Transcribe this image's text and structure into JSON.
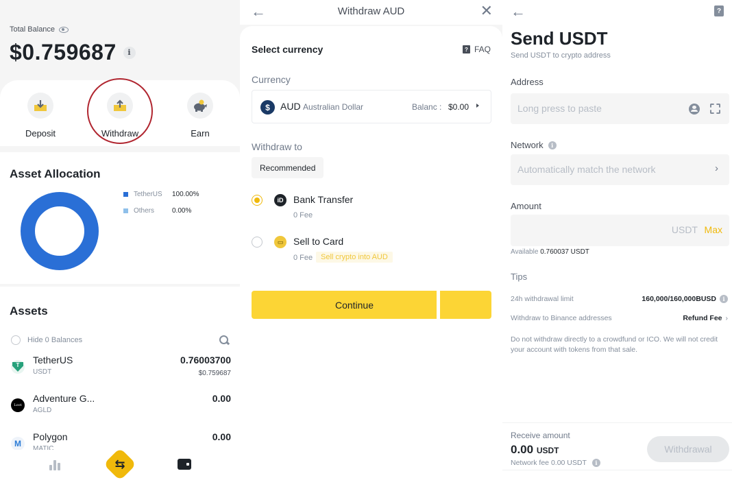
{
  "portfolio": {
    "total_balance_label": "Total Balance",
    "total_balance_value": "$0.759687",
    "info_glyph": "i",
    "actions": [
      {
        "label": "Deposit",
        "icon": "deposit-icon"
      },
      {
        "label": "Withdraw",
        "icon": "withdraw-icon",
        "highlighted": true
      },
      {
        "label": "Earn",
        "icon": "piggy-bank-icon"
      }
    ],
    "allocation": {
      "title": "Asset Allocation",
      "legend": [
        {
          "name": "TetherUS",
          "percent": "100.00%",
          "color": "#2a6fd6"
        },
        {
          "name": "Others",
          "percent": "0.00%",
          "color": "#8fc0ea"
        }
      ]
    },
    "assets": {
      "title": "Assets",
      "hide_zero_label": "Hide 0 Balances",
      "items": [
        {
          "name": "TetherUS",
          "symbol": "USDT",
          "amount": "0.76003700",
          "fiat": "$0.759687",
          "logo_glyph": "T"
        },
        {
          "name": "Adventure G...",
          "symbol": "AGLD",
          "amount": "0.00",
          "fiat": "",
          "logo_glyph": "Loot"
        },
        {
          "name": "Polygon",
          "symbol": "MATIC",
          "amount": "0.00",
          "fiat": "",
          "logo_glyph": "M"
        }
      ]
    },
    "bottom_nav": {
      "trade_glyph": "⇆"
    }
  },
  "withdraw_aud": {
    "back_glyph": "←",
    "title": "Withdraw AUD",
    "close_glyph": "✕",
    "select_currency": "Select currency",
    "faq_label": "FAQ",
    "faq_glyph": "?",
    "currency_label": "Currency",
    "currency": {
      "glyph": "$",
      "code": "AUD",
      "name": "Australian Dollar",
      "balance_label": "Balanc :",
      "balance_value": "$0.00"
    },
    "withdraw_to_label": "Withdraw to",
    "recommended_label": "Recommended",
    "methods": [
      {
        "title": "Bank Transfer",
        "fee": "0 Fee",
        "tag": "",
        "selected": true,
        "glyph": "iD"
      },
      {
        "title": "Sell to Card",
        "fee": "0 Fee",
        "tag": "Sell crypto into AUD",
        "selected": false,
        "glyph": "▭"
      }
    ],
    "continue_label": "Continue"
  },
  "send_usdt": {
    "back_glyph": "←",
    "help_glyph": "?",
    "title": "Send USDT",
    "subtitle": "Send USDT to crypto address",
    "address_label": "Address",
    "address_placeholder": "Long press to paste",
    "network_label": "Network",
    "network_placeholder": "Automatically match the network",
    "chevron": "›",
    "amount_label": "Amount",
    "amount_value": "",
    "amount_unit": "USDT",
    "max_label": "Max",
    "available_label": "Available",
    "available_value": "0.760037 USDT",
    "tips_title": "Tips",
    "tips": [
      {
        "label": "24h withdrawal limit",
        "value": "160,000/160,000BUSD"
      },
      {
        "label": "Withdraw to Binance addresses",
        "value": "Refund Fee"
      }
    ],
    "tip_note": "Do not withdraw directly to a crowdfund or ICO. We will not credit your account with tokens from that sale.",
    "receive_label": "Receive amount",
    "receive_value": "0.00",
    "receive_unit": "USDT",
    "network_fee": "Network fee 0.00 USDT",
    "withdrawal_button": "Withdrawal"
  }
}
